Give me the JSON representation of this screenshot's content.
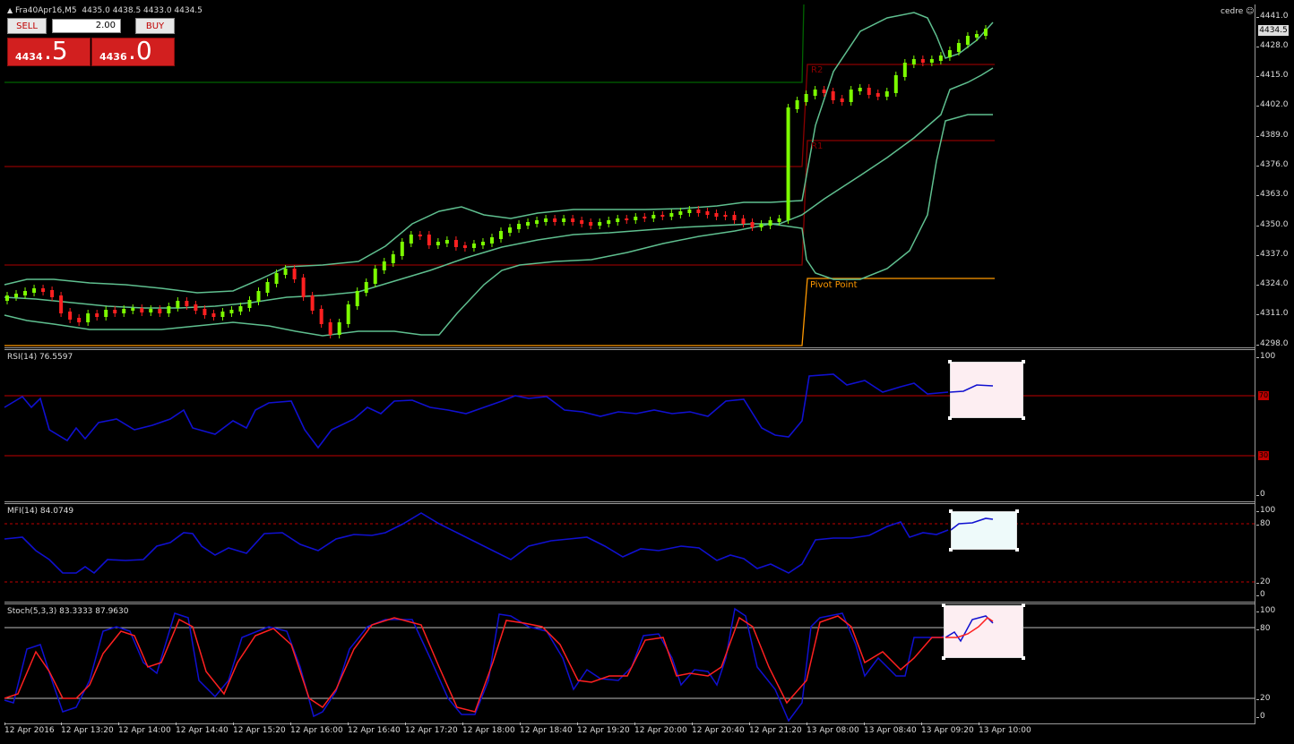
{
  "header": {
    "symbol_line": "Fra40Apr16,M5",
    "ohlc": "4435.0 4438.5 4433.0 4434.5",
    "user": "cedre"
  },
  "trade_panel": {
    "sell_label": "SELL",
    "buy_label": "BUY",
    "quantity": "2.00",
    "sell_small": "4434",
    "sell_big": ".5",
    "buy_small": "4436",
    "buy_big": ".0"
  },
  "price_axis": {
    "current_price": "4434.5",
    "ticks": [
      "4441.0",
      "4428.0",
      "4415.0",
      "4402.0",
      "4389.0",
      "4376.0",
      "4363.0",
      "4350.0",
      "4337.0",
      "4324.0",
      "4311.0",
      "4298.0"
    ]
  },
  "pivot_labels": {
    "r2": "R2",
    "r1": "R1",
    "pivot": "Pivot Point"
  },
  "indicators": {
    "rsi": {
      "label": "RSI(14) 76.5597",
      "levels": [
        "70",
        "30"
      ],
      "ticks": [
        "100",
        "0"
      ]
    },
    "mfi": {
      "label": "MFI(14) 84.0749",
      "ticks": [
        "100",
        "80",
        "20",
        "0"
      ]
    },
    "stoch": {
      "label": "Stoch(5,3,3) 83.3333 87.9630",
      "ticks": [
        "100",
        "80",
        "20",
        "0"
      ]
    }
  },
  "time_axis": [
    "12 Apr 2016",
    "12 Apr 13:20",
    "12 Apr 14:00",
    "12 Apr 14:40",
    "12 Apr 15:20",
    "12 Apr 16:00",
    "12 Apr 16:40",
    "12 Apr 17:20",
    "12 Apr 18:00",
    "12 Apr 18:40",
    "12 Apr 19:20",
    "12 Apr 20:00",
    "12 Apr 20:40",
    "12 Apr 21:20",
    "13 Apr 08:00",
    "13 Apr 08:40",
    "13 Apr 09:20",
    "13 Apr 10:00"
  ],
  "colors": {
    "bull": "#7cfc00",
    "bear": "#ff2020",
    "bands": "#5fbf8f",
    "rsi_line": "#1010d0",
    "signal": "#ff2020",
    "pivot": "#ff9900",
    "resistance": "#8b0000",
    "upper_level": "#006400"
  }
}
